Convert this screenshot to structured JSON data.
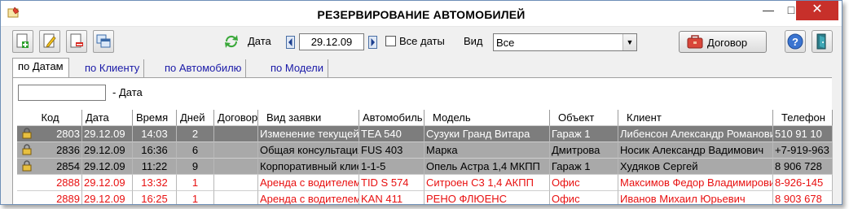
{
  "window": {
    "title": "РЕЗЕРВИРОВАНИЕ АВТОМОБИЛЕЙ",
    "minimize_glyph": "—",
    "maximize_glyph": "□",
    "close_glyph": "✕"
  },
  "toolbar": {
    "date_label": "Дата",
    "date_value": "29.12.09",
    "all_dates_label": "Все даты",
    "all_dates_checked": false,
    "view_label": "Вид",
    "view_value": "Все",
    "contract_label": "Договор",
    "icons": [
      "add-icon",
      "edit-icon",
      "delete-icon",
      "copy-icon",
      "refresh-icon",
      "arrow-left-icon",
      "arrow-right-icon",
      "briefcase-icon",
      "help-icon",
      "exit-icon"
    ]
  },
  "tabs": [
    {
      "label": "по Датам",
      "active": true
    },
    {
      "label": "по Клиенту",
      "active": false
    },
    {
      "label": "по Автомобилю",
      "active": false
    },
    {
      "label": "по Модели",
      "active": false
    }
  ],
  "filter": {
    "value": "",
    "label": "- Дата"
  },
  "grid": {
    "columns": [
      "Код",
      "Дата",
      "Время",
      "Дней",
      "Договор",
      "Вид заявки",
      "Автомобиль",
      "Модель",
      "Объект",
      "Клиент",
      "Телефон"
    ],
    "rows": [
      {
        "locked": true,
        "style": "sel",
        "code": "2803",
        "date": "29.12.09",
        "time": "14:03",
        "days": "2",
        "contract": "",
        "type": "Изменение текущей",
        "car": "TEA 540",
        "model": "Сузуки Гранд Витара",
        "object": "Гараж 1",
        "client": "Либенсон Александр Романович",
        "phone": "510 91 10"
      },
      {
        "locked": true,
        "style": "grey",
        "code": "2836",
        "date": "29.12.09",
        "time": "16:36",
        "days": "6",
        "contract": "",
        "type": "Общая консультация",
        "car": "FUS 403",
        "model": "Марка",
        "object": "Дмитрова",
        "client": "Носик Александр Вадимович",
        "phone": "+7-919-963"
      },
      {
        "locked": true,
        "style": "grey",
        "code": "2854",
        "date": "29.12.09",
        "time": "11:22",
        "days": "9",
        "contract": "",
        "type": "Корпоративный клиент",
        "car": "1-1-5",
        "model": "Опель Астра 1,4 МКПП",
        "object": "Гараж 1",
        "client": "Худяков Сергей",
        "phone": "8 906 728"
      },
      {
        "locked": false,
        "style": "red",
        "code": "2888",
        "date": "29.12.09",
        "time": "13:32",
        "days": "1",
        "contract": "",
        "type": "Аренда с водителем",
        "car": "TID S 574",
        "model": "Ситроен С3 1,4 АКПП",
        "object": "Офис",
        "client": "Максимов Федор Владимирович",
        "phone": "8-926-145"
      },
      {
        "locked": false,
        "style": "red",
        "code": "2889",
        "date": "29.12.09",
        "time": "16:25",
        "days": "1",
        "contract": "",
        "type": "Аренда с водителем",
        "car": "KAN 411",
        "model": "РЕНО ФЛЮЕНС",
        "object": "Офис",
        "client": "Иванов Михаил Юрьевич",
        "phone": "8 903 678"
      }
    ]
  }
}
